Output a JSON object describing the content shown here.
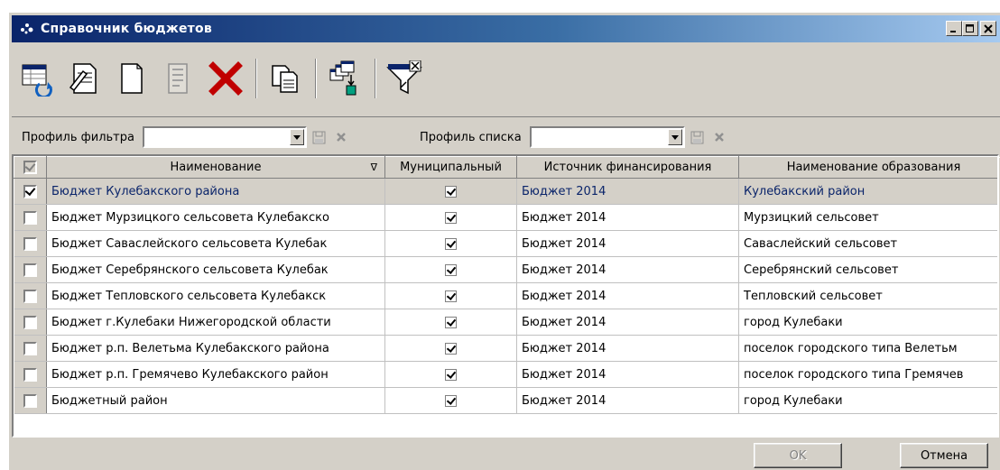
{
  "window": {
    "title": "Справочник бюджетов",
    "controls": [
      "minimize-icon",
      "maximize-icon",
      "close-icon"
    ]
  },
  "toolbar": {
    "buttons": [
      "refresh-list-icon",
      "edit-document-icon",
      "new-document-icon",
      "properties-icon",
      "delete-icon",
      "copy-icon",
      "cascade-icon",
      "filter-icon"
    ]
  },
  "filter_bar": {
    "filter_profile_label": "Профиль фильтра",
    "filter_profile_value": "",
    "list_profile_label": "Профиль списка",
    "list_profile_value": ""
  },
  "grid": {
    "columns": [
      "Наименование",
      "Муниципальный",
      "Источник финансирования",
      "Наименование образования"
    ],
    "sort_indicator": "∇",
    "rows": [
      {
        "checked": true,
        "name": "Бюджет Кулебакского района",
        "municipal": true,
        "source": "Бюджет 2014",
        "entity": "Кулебакский район"
      },
      {
        "checked": false,
        "name": "Бюджет Мурзицкого сельсовета Кулебакско",
        "municipal": true,
        "source": "Бюджет 2014",
        "entity": "Мурзицкий сельсовет"
      },
      {
        "checked": false,
        "name": "Бюджет Саваслейского сельсовета Кулебак",
        "municipal": true,
        "source": "Бюджет 2014",
        "entity": "Саваслейский сельсовет"
      },
      {
        "checked": false,
        "name": "Бюджет Серебрянского сельсовета Кулебак",
        "municipal": true,
        "source": "Бюджет 2014",
        "entity": "Серебрянский сельсовет"
      },
      {
        "checked": false,
        "name": "Бюджет Тепловского сельсовета Кулебакск",
        "municipal": true,
        "source": "Бюджет 2014",
        "entity": "Тепловский сельсовет"
      },
      {
        "checked": false,
        "name": "Бюджет г.Кулебаки Нижегородской области",
        "municipal": true,
        "source": "Бюджет 2014",
        "entity": "город Кулебаки"
      },
      {
        "checked": false,
        "name": "Бюджет р.п. Велетьма Кулебакского района",
        "municipal": true,
        "source": "Бюджет 2014",
        "entity": "поселок городского типа Велетьм"
      },
      {
        "checked": false,
        "name": "Бюджет р.п. Гремячево Кулебакского район",
        "municipal": true,
        "source": "Бюджет 2014",
        "entity": "поселок городского типа Гремячев"
      },
      {
        "checked": false,
        "name": "Бюджетный район",
        "municipal": true,
        "source": "Бюджет 2014",
        "entity": "город Кулебаки"
      }
    ]
  },
  "footer": {
    "ok_label": "OK",
    "cancel_label": "Отмена"
  }
}
